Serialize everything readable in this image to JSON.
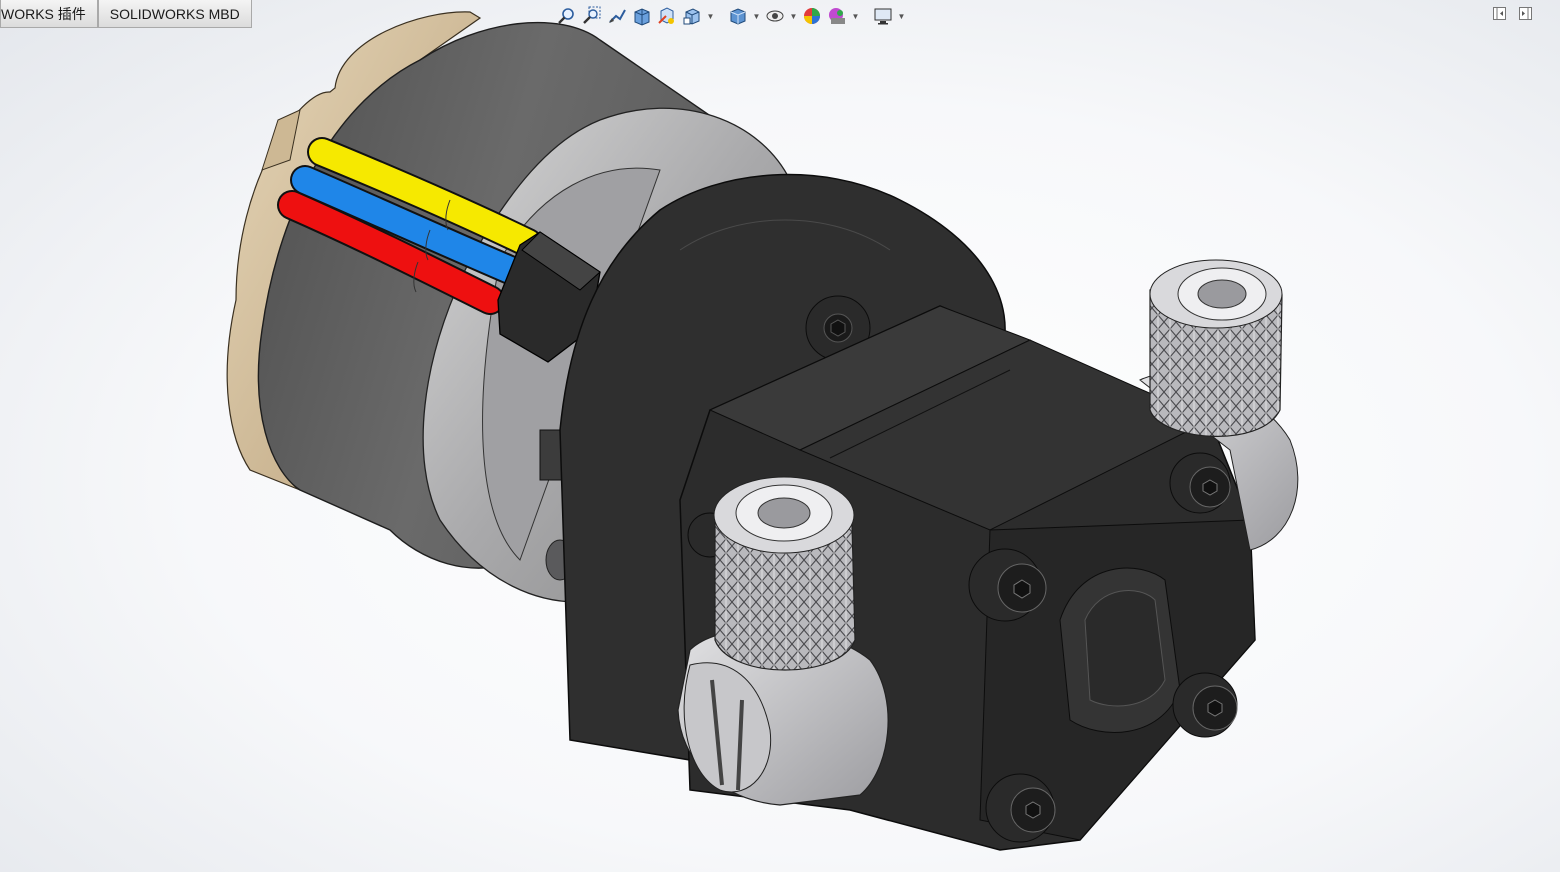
{
  "command_manager": {
    "tabs": [
      {
        "label": "WORKS 插件"
      },
      {
        "label": "SOLIDWORKS MBD"
      }
    ]
  },
  "heads_up_toolbar": {
    "icons": [
      "zoom-to-fit-icon",
      "zoom-to-area-icon",
      "previous-view-icon",
      "section-view-icon",
      "dynamic-annotation-views-icon",
      "view-orientation-icon",
      "display-style-icon",
      "hide-show-items-icon",
      "edit-appearance-icon",
      "apply-scene-icon",
      "view-settings-icon"
    ]
  },
  "window_controls": {
    "icons": [
      "collapse-left-panel-icon",
      "expand-right-panel-icon"
    ]
  },
  "model": {
    "name": "pump-motor-assembly",
    "colors": {
      "motor_body": "#5d5d5d",
      "end_cap": "#d9c7a8",
      "wire_yellow": "#f6e900",
      "wire_blue": "#1f86e8",
      "wire_red": "#ee1010",
      "pump_housing": "#2f2f2f",
      "fittings": "#c8c8cc"
    }
  }
}
